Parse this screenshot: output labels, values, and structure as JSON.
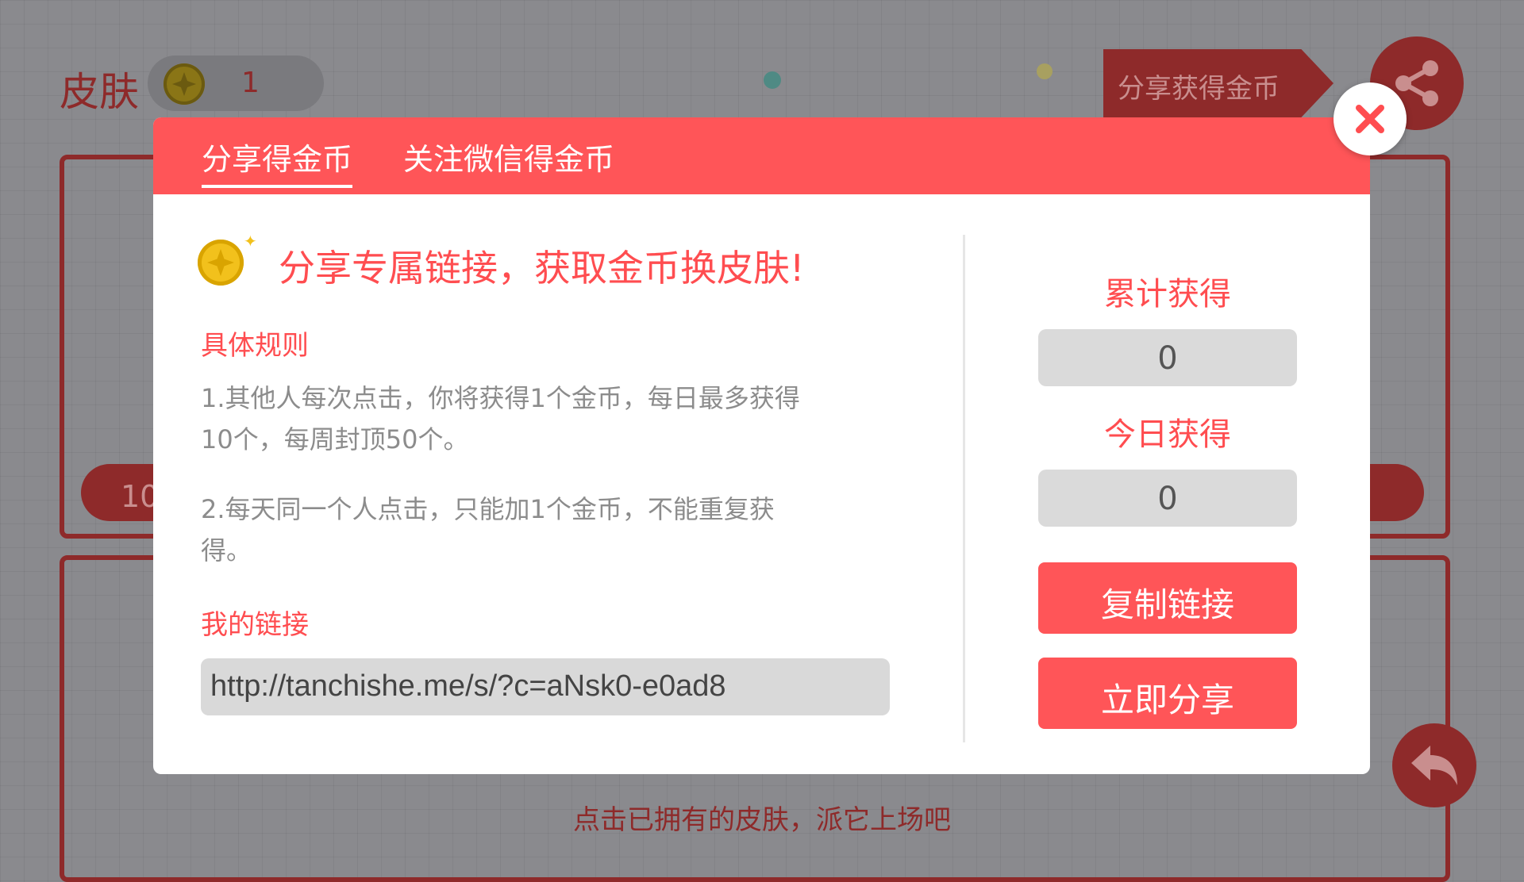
{
  "background": {
    "title": "皮肤",
    "coin_count": "1",
    "share_tag": "分享获得金币",
    "pill_partial_value": "10",
    "bottom_hint": "点击已拥有的皮肤，派它上场吧"
  },
  "modal": {
    "tabs": [
      {
        "label": "分享得金币",
        "active": true
      },
      {
        "label": "关注微信得金币",
        "active": false
      }
    ],
    "headline": "分享专属链接，获取金币换皮肤!",
    "rules_title": "具体规则",
    "rules": [
      "1.其他人每次点击，你将获得1个金币，每日最多获得10个，每周封顶50个。",
      "2.每天同一个人点击，只能加1个金币，不能重复获得。"
    ],
    "my_link_label": "我的链接",
    "my_link": "http://tanchishe.me/s/?c=aNsk0-e0ad8",
    "total_label": "累计获得",
    "total_value": "0",
    "today_label": "今日获得",
    "today_value": "0",
    "copy_button": "复制链接",
    "share_button": "立即分享"
  },
  "colors": {
    "accent": "#ff5558",
    "accent_text": "#ff4d50",
    "overlay_red": "#8e2a2a",
    "coin_gold": "#f2c11c"
  },
  "icons": [
    "coin-icon",
    "share-icon",
    "close-icon",
    "back-icon",
    "sparkle-icon"
  ]
}
